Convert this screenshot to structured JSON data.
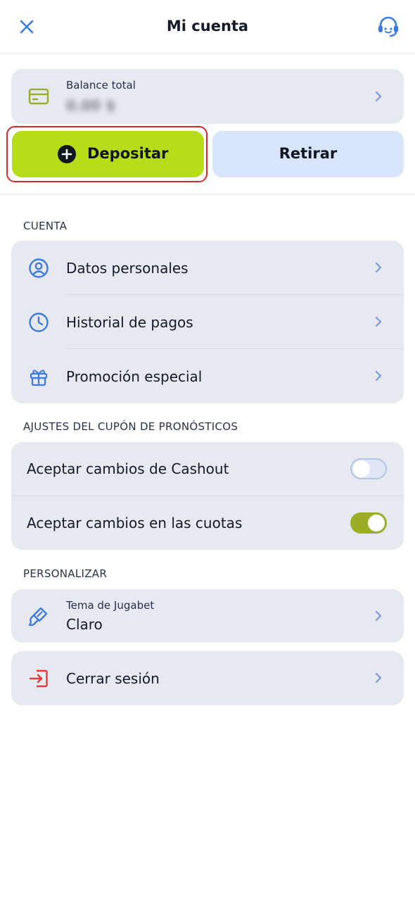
{
  "header": {
    "title": "Mi cuenta",
    "close_icon": "close-icon",
    "support_icon": "headset-icon"
  },
  "balance": {
    "label": "Balance total",
    "amount": "0.00 $"
  },
  "actions": {
    "deposit_label": "Depositar",
    "withdraw_label": "Retirar"
  },
  "account": {
    "section_title": "CUENTA",
    "items": [
      {
        "label": "Datos personales",
        "icon": "user-circle-icon"
      },
      {
        "label": "Historial de pagos",
        "icon": "clock-icon"
      },
      {
        "label": "Promoción especial",
        "icon": "gift-icon"
      }
    ]
  },
  "coupon_settings": {
    "section_title": "AJUSTES DEL CUPÓN DE PRONÓSTICOS",
    "items": [
      {
        "label": "Aceptar cambios de Cashout",
        "enabled": false
      },
      {
        "label": "Aceptar cambios en las cuotas",
        "enabled": true
      }
    ]
  },
  "personalize": {
    "section_title": "PERSONALIZAR",
    "theme_label": "Tema de Jugabet",
    "theme_value": "Claro"
  },
  "logout": {
    "label": "Cerrar sesión"
  },
  "colors": {
    "accent_blue": "#3d7ae0",
    "deposit_green": "#b6dc1a",
    "toggle_on": "#9aaf25",
    "logout_red": "#e23a3a",
    "highlight_red": "#d42a2a"
  }
}
